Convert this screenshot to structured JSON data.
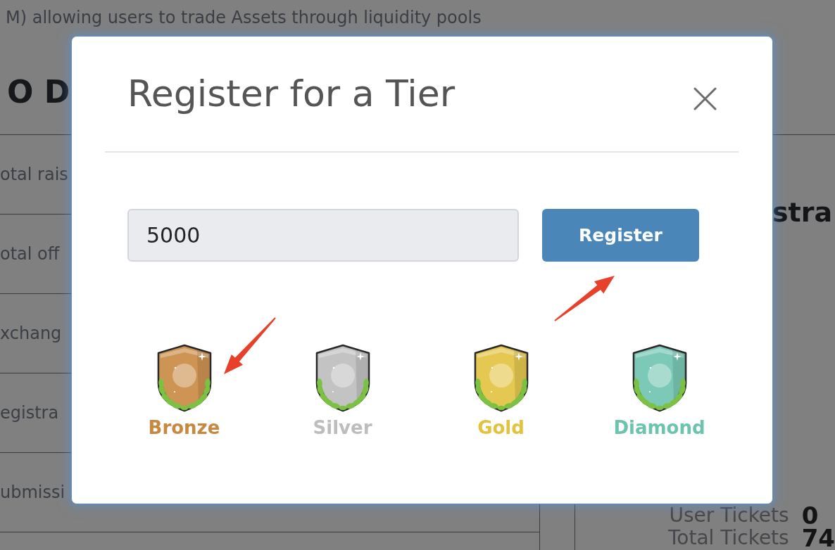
{
  "background": {
    "intro": "M) allowing users to trade Assets through liquidity pools",
    "heading": "O D",
    "detail_rows": [
      "otal rais",
      "otal off",
      "xchang",
      "egistra",
      "ubmissi"
    ],
    "side_heading": "stra",
    "stats": [
      {
        "label": "User Tickets",
        "value": "0"
      },
      {
        "label": "Total Tickets",
        "value": "74"
      }
    ]
  },
  "dialog": {
    "title": "Register for a Tier",
    "amount_field": {
      "value": "5000"
    },
    "register_button": "Register",
    "tiers": [
      {
        "name": "Bronze",
        "color": "#c98840"
      },
      {
        "name": "Silver",
        "color": "#bdbdbd"
      },
      {
        "name": "Gold",
        "color": "#e3c23e"
      },
      {
        "name": "Diamond",
        "color": "#6cc3ae"
      }
    ]
  }
}
